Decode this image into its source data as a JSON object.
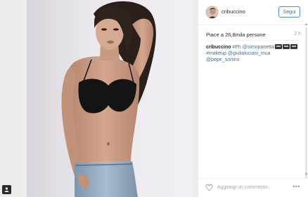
{
  "post": {
    "username": "cribuccino",
    "follow_label": "Segui",
    "likes": "Piace a 26,8mila persone",
    "time": "2 h"
  },
  "caption": {
    "author": "cribuccino",
    "tag_ph": "#Ph",
    "mention_photographer": "@simopanetta",
    "tag_makeup": "#makeup",
    "mention_mua": "@giulialuciani_mua",
    "mention_pepe": "@pepe_sortino"
  },
  "comment": {
    "placeholder": "Aggiungi un commento..."
  },
  "icons": {
    "download": "download-icon",
    "like": "heart-icon",
    "more": "more-options-icon"
  },
  "colors": {
    "link": "#3f729b",
    "follow_border": "#4a8bd1"
  }
}
